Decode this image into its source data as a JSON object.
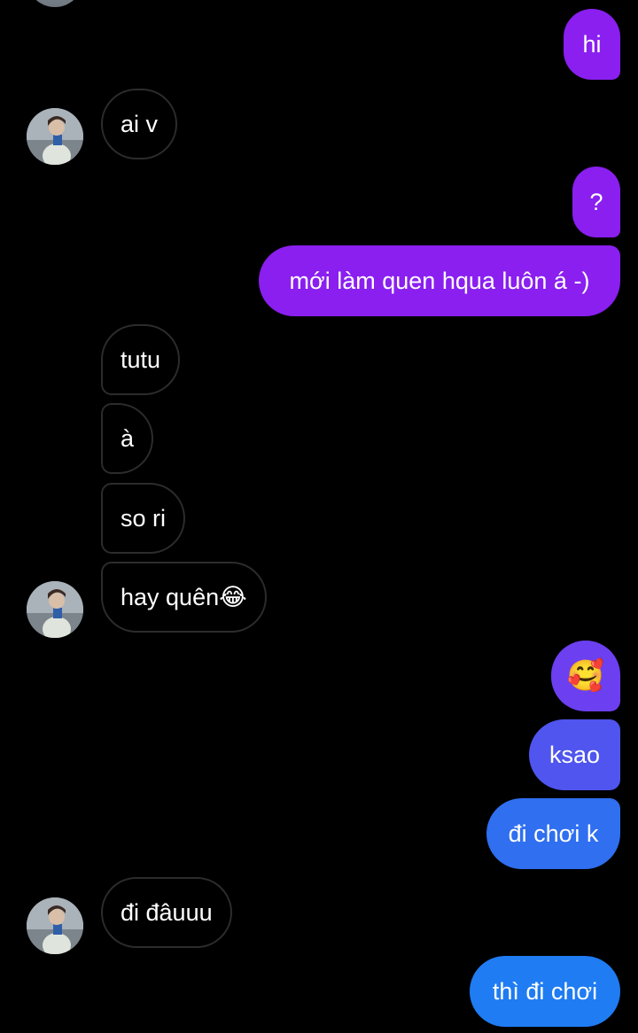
{
  "thread": {
    "messages": [
      {
        "id": "m1",
        "direction": "outgoing",
        "text": "hi"
      },
      {
        "id": "m2",
        "direction": "incoming",
        "text": "ai v"
      },
      {
        "id": "m3",
        "direction": "outgoing",
        "text": "?"
      },
      {
        "id": "m4",
        "direction": "outgoing",
        "text": "mới làm quen hqua luôn á -)"
      },
      {
        "id": "m5",
        "direction": "incoming",
        "text": "tutu"
      },
      {
        "id": "m6",
        "direction": "incoming",
        "text": "à"
      },
      {
        "id": "m7",
        "direction": "incoming",
        "text": "so ri"
      },
      {
        "id": "m8",
        "direction": "incoming",
        "text": "hay quên",
        "emoji": "😂"
      },
      {
        "id": "m9",
        "direction": "outgoing",
        "emoji": "🥰"
      },
      {
        "id": "m10",
        "direction": "outgoing",
        "text": "ksao"
      },
      {
        "id": "m11",
        "direction": "outgoing",
        "text": "đi chơi k"
      },
      {
        "id": "m12",
        "direction": "incoming",
        "text": "đi đâuuu"
      },
      {
        "id": "m13",
        "direction": "outgoing",
        "text": "thì đi chơi"
      }
    ]
  },
  "colors": {
    "background": "#000000",
    "outgoing_purple": "#8a1ff0",
    "outgoing_violet": "#6c3ff0",
    "outgoing_indigo": "#4f55ee",
    "outgoing_blue": "#2f6ff0",
    "outgoing_blue_2": "#1f7cf2",
    "incoming_border": "#2c2c2c",
    "text": "#ffffff"
  },
  "icons": {
    "avatar": "contact-avatar-photo"
  }
}
